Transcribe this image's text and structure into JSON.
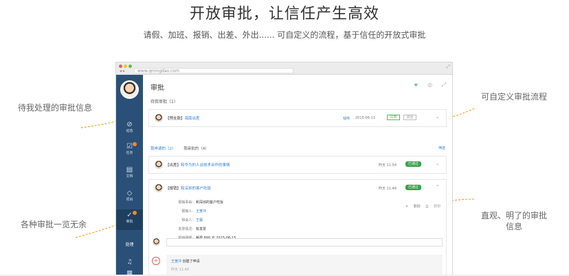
{
  "hero": {
    "title": "开放审批，让信任产生高效",
    "subtitle": "请假、加班、报销、出差、外出...... 可自定义的流程，基于信任的开放式审批"
  },
  "annotations": {
    "pending_info": "待我处理的审批信息",
    "all_types": "各种审批一览无余",
    "custom_flow": "可自定义审批流程",
    "intuitive_line1": "直观、明了的审批",
    "intuitive_line2": "信息"
  },
  "browser": {
    "url": "www.qmingdao.com",
    "nav_arrows": "◂ ▸"
  },
  "sidebar": {
    "items": [
      {
        "icon": "⊘",
        "label": "动态"
      },
      {
        "icon": "☑",
        "label": "任务"
      },
      {
        "icon": "▤",
        "label": "文档"
      },
      {
        "icon": "◇",
        "label": "项目"
      },
      {
        "icon": "✓",
        "label": "审批"
      }
    ],
    "processing_label": "处理",
    "bell_icon": "♫",
    "grid_icon": "▦"
  },
  "main": {
    "title": "审批",
    "add_icon": "+",
    "settings_icon": "◎",
    "fullscreen_icon": "⤢",
    "pending_label": "待我审批（1）",
    "pending_card": {
      "title_prefix": "【预支款】",
      "title_link": "海南出差",
      "applicant": "钱伟",
      "date": "2015-06-11",
      "approve": "同意",
      "reject": "驳回"
    },
    "tabs": [
      {
        "label": "我申请的（2）",
        "active": true
      },
      {
        "label": "我审批的（4）",
        "active": false
      }
    ],
    "filter": "筛选",
    "cards": [
      {
        "prefix": "【出差】",
        "link": "和华为的人谈技术合作的事情",
        "time": "昨天 11:54",
        "status": "已通过"
      },
      {
        "prefix": "【报销】",
        "link": "和深圳的客户吃饭",
        "time": "昨天 11:48",
        "status": "已通过"
      }
    ],
    "detail": {
      "rows": [
        {
          "k": "报销事由:",
          "v": "和深圳的客户吃饭"
        },
        {
          "k": "报销人:",
          "v": "王宽冲",
          "link": true
        },
        {
          "k": "知会人:",
          "v": "王霜",
          "link": true
        },
        {
          "k": "发票情况:",
          "v": "有发票"
        },
        {
          "k": "报销明细:",
          "v": "餐费    890 元    2015-06-15"
        },
        {
          "k": "",
          "v": "总计:   890 元"
        }
      ],
      "delete": "删除",
      "print": "打印"
    },
    "log": {
      "user": "王宽冲",
      "action": " 创建了申请",
      "time": "昨天 11:48"
    }
  }
}
